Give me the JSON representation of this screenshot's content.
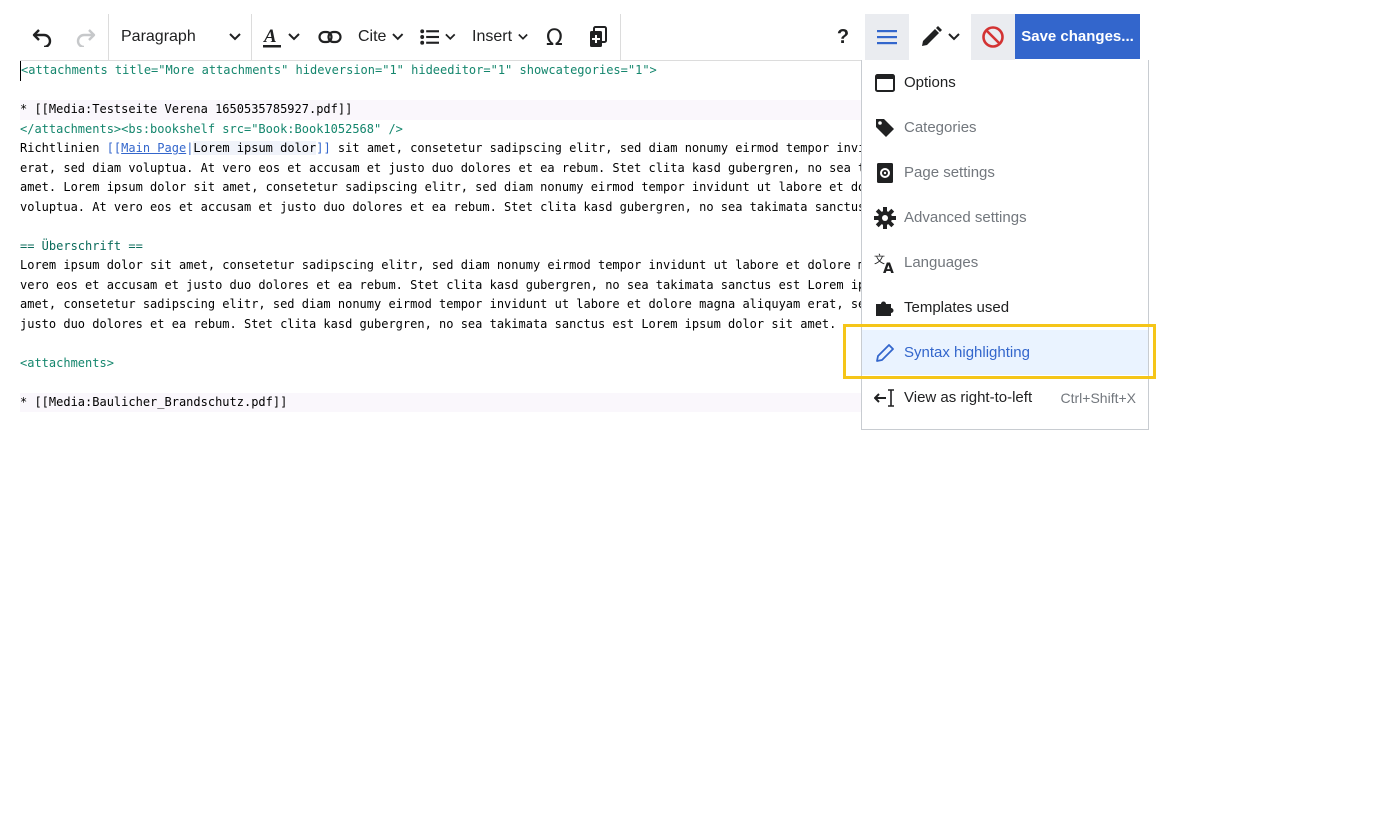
{
  "toolbar": {
    "paragraph_label": "Paragraph",
    "cite_label": "Cite",
    "insert_label": "Insert",
    "help_label": "?",
    "save_label": "Save changes..."
  },
  "editor": {
    "lines": [
      {
        "parts": [
          {
            "t": "<attachments title=\"More attachments\" hideversion=\"1\" hideeditor=\"1\" showcategories=\"1\">",
            "c": "tag"
          }
        ]
      },
      {
        "parts": [
          {
            "t": "",
            "c": ""
          }
        ]
      },
      {
        "parts": [
          {
            "t": "* [[Media:Testseite Verena 1650535785927.pdf]]",
            "c": ""
          }
        ]
      },
      {
        "parts": [
          {
            "t": "</attachments><bs:bookshelf src=\"Book:Book1052568\" />",
            "c": "tag"
          }
        ]
      },
      {
        "parts": [
          {
            "t": "Richtlinien ",
            "c": ""
          },
          {
            "t": "[[",
            "c": "link-br"
          },
          {
            "t": "Main Page",
            "c": "link-target"
          },
          {
            "t": "|",
            "c": "link-br"
          },
          {
            "t": "Lorem ipsum dolor",
            "c": "link-text"
          },
          {
            "t": "]]",
            "c": "link-br"
          },
          {
            "t": " sit amet, consetetur sadipscing elitr, sed diam nonumy eirmod tempor invidunt",
            "c": ""
          }
        ]
      },
      {
        "parts": [
          {
            "t": "erat, sed diam voluptua. At vero eos et accusam et justo duo dolores et ea rebum. Stet clita kasd gubergren, no sea takim",
            "c": ""
          }
        ]
      },
      {
        "parts": [
          {
            "t": "amet. Lorem ipsum dolor sit amet, consetetur sadipscing elitr, sed diam nonumy eirmod tempor invidunt ut labore et dolor",
            "c": ""
          }
        ]
      },
      {
        "parts": [
          {
            "t": "voluptua. At vero eos et accusam et justo duo dolores et ea rebum. Stet clita kasd gubergren, no sea takimata sanctus est",
            "c": ""
          }
        ]
      },
      {
        "parts": [
          {
            "t": "",
            "c": ""
          }
        ]
      },
      {
        "parts": [
          {
            "t": "== Überschrift ==",
            "c": "heading"
          }
        ]
      },
      {
        "parts": [
          {
            "t": "Lorem ipsum dolor sit amet, consetetur sadipscing elitr, sed diam nonumy eirmod tempor invidunt ut labore et dolore magn",
            "c": ""
          }
        ]
      },
      {
        "parts": [
          {
            "t": "vero eos et accusam et justo duo dolores et ea rebum. Stet clita kasd gubergren, no sea takimata sanctus est Lorem ipsum",
            "c": ""
          }
        ]
      },
      {
        "parts": [
          {
            "t": "amet, consetetur sadipscing elitr, sed diam nonumy eirmod tempor invidunt ut labore et dolore magna aliquyam erat, sed d",
            "c": ""
          }
        ]
      },
      {
        "parts": [
          {
            "t": "justo duo dolores et ea rebum. Stet clita kasd gubergren, no sea takimata sanctus est Lorem ipsum dolor sit amet.",
            "c": ""
          }
        ]
      },
      {
        "parts": [
          {
            "t": "",
            "c": ""
          }
        ]
      },
      {
        "parts": [
          {
            "t": "<attachments>",
            "c": "tag"
          }
        ]
      },
      {
        "parts": [
          {
            "t": "",
            "c": ""
          }
        ]
      },
      {
        "parts": [
          {
            "t": "* [[Media:Baulicher_Brandschutz.pdf]]",
            "c": ""
          }
        ]
      }
    ]
  },
  "menu": {
    "items": [
      {
        "name": "options",
        "label": "Options",
        "icon": "window-icon",
        "muted": false,
        "selected": false,
        "shortcut": ""
      },
      {
        "name": "categories",
        "label": "Categories",
        "icon": "tag-icon",
        "muted": true,
        "selected": false,
        "shortcut": ""
      },
      {
        "name": "page-settings",
        "label": "Page settings",
        "icon": "page-gear-icon",
        "muted": true,
        "selected": false,
        "shortcut": ""
      },
      {
        "name": "advanced-settings",
        "label": "Advanced settings",
        "icon": "gear-icon",
        "muted": true,
        "selected": false,
        "shortcut": ""
      },
      {
        "name": "languages",
        "label": "Languages",
        "icon": "translate-icon",
        "muted": true,
        "selected": false,
        "shortcut": ""
      },
      {
        "name": "templates-used",
        "label": "Templates used",
        "icon": "puzzle-icon",
        "muted": false,
        "selected": false,
        "shortcut": ""
      },
      {
        "name": "syntax-highlighting",
        "label": "Syntax highlighting",
        "icon": "pencil-icon",
        "muted": false,
        "selected": true,
        "shortcut": ""
      },
      {
        "name": "view-rtl",
        "label": "View as right-to-left",
        "icon": "rtl-cursor-icon",
        "muted": false,
        "selected": false,
        "shortcut": "Ctrl+Shift+X"
      }
    ]
  },
  "colors": {
    "accent": "#3366cc",
    "highlight": "#f5c518",
    "cancel": "#d33333"
  }
}
